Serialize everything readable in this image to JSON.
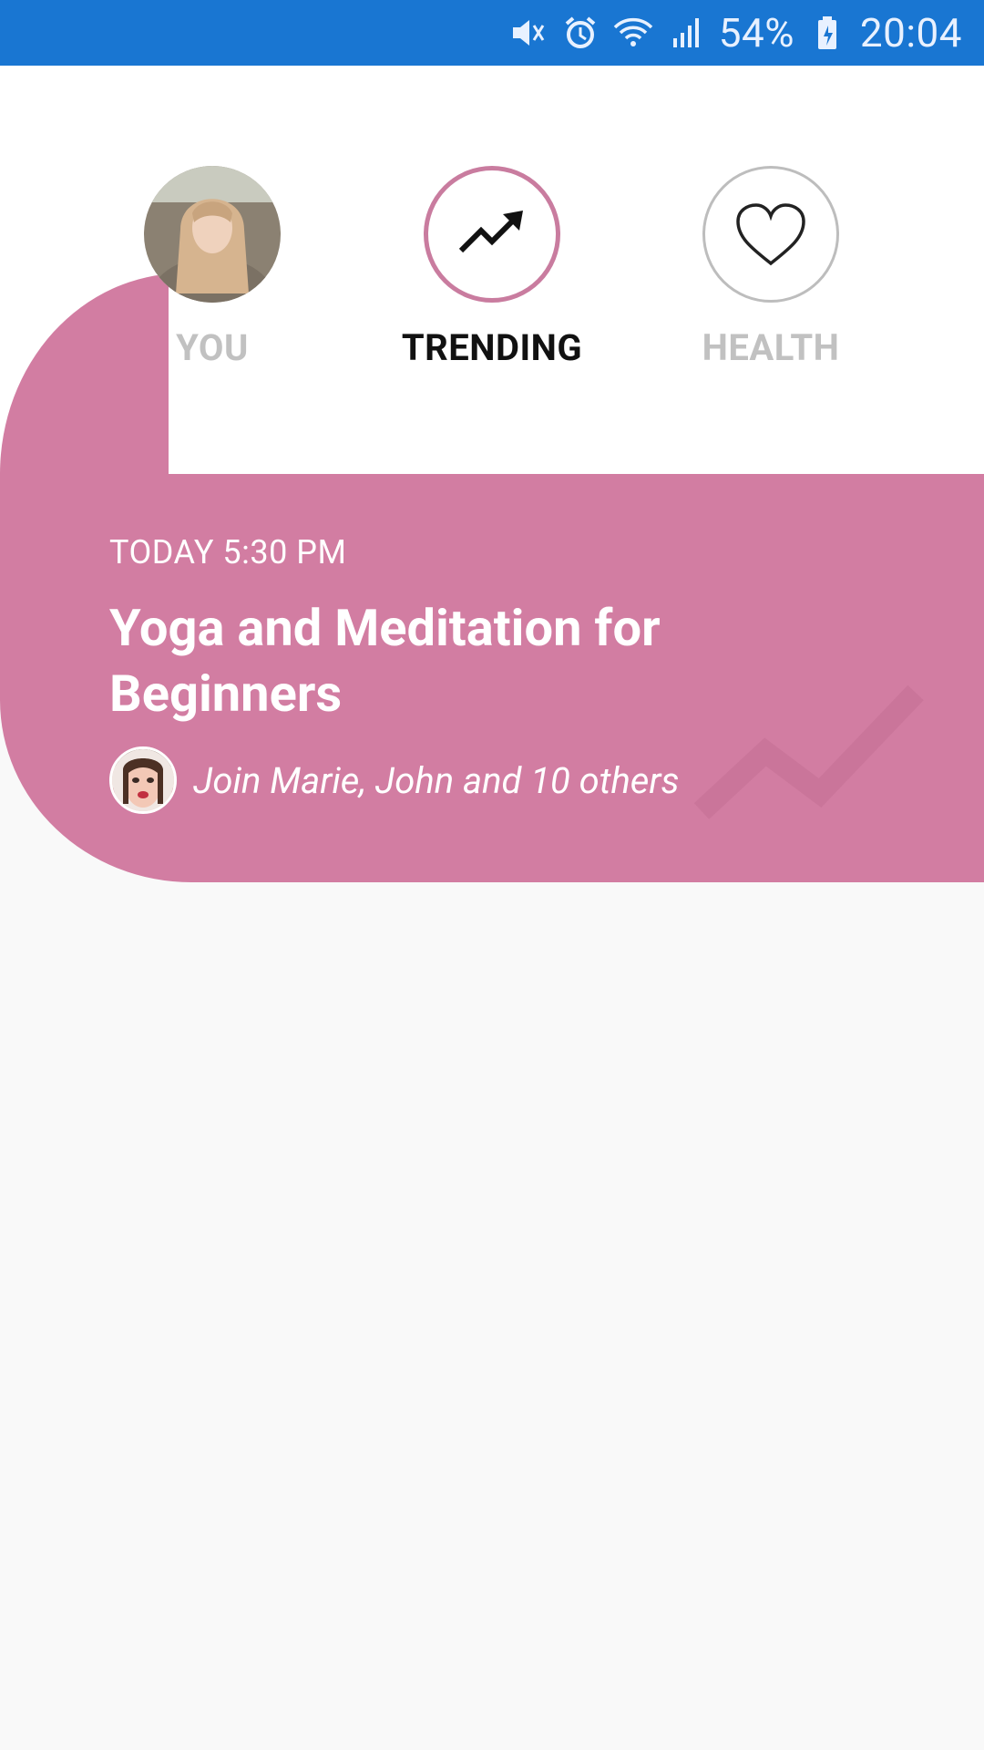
{
  "status_bar": {
    "battery": "54%",
    "time": "20:04",
    "icons": [
      "mute-icon",
      "alarm-icon",
      "wifi-icon",
      "signal-icon",
      "battery-icon"
    ]
  },
  "tabs": [
    {
      "label": "YOU",
      "icon": "user-avatar",
      "active": false
    },
    {
      "label": "TRENDING",
      "icon": "trending-up-icon",
      "active": true
    },
    {
      "label": "HEALTH",
      "icon": "heart-icon",
      "active": false
    }
  ],
  "event": {
    "time": "TODAY 5:30 PM",
    "title": "Yoga and Meditation for Beginners",
    "participants": "Join Marie, John and 10 others"
  },
  "colors": {
    "status_bar": "#1976d2",
    "accent": "#d27da2",
    "active_ring": "#c97c9f",
    "inactive_label": "#c1c1c1"
  }
}
